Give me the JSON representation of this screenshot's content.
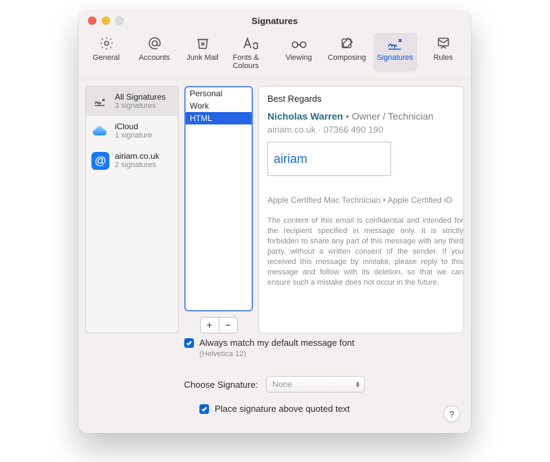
{
  "window": {
    "title": "Signatures"
  },
  "toolbar": {
    "items": [
      {
        "id": "general",
        "label": "General"
      },
      {
        "id": "accounts",
        "label": "Accounts"
      },
      {
        "id": "junk",
        "label": "Junk Mail"
      },
      {
        "id": "fonts",
        "label": "Fonts & Colours"
      },
      {
        "id": "viewing",
        "label": "Viewing"
      },
      {
        "id": "composing",
        "label": "Composing"
      },
      {
        "id": "signatures",
        "label": "Signatures"
      },
      {
        "id": "rules",
        "label": "Rules"
      }
    ],
    "selected": "signatures"
  },
  "accounts": [
    {
      "id": "all",
      "name": "All Signatures",
      "sub": "3 signatures",
      "icon": "signature"
    },
    {
      "id": "icloud",
      "name": "iCloud",
      "sub": "1 signature",
      "icon": "icloud"
    },
    {
      "id": "airiam",
      "name": "airiam.co.uk",
      "sub": "2 signatures",
      "icon": "at"
    }
  ],
  "accounts_selected": "all",
  "signatures": [
    "Personal",
    "Work",
    "HTML"
  ],
  "signature_selected": "HTML",
  "preview": {
    "name": "Best Regards",
    "person": "Nicholas Warren",
    "sep": " • ",
    "role": "Owner / Technician",
    "domain": "airiam.co.uk",
    "phone": "07366 490 190",
    "logo_text": "airiam",
    "cert": "Apple Certified Mac Technician • Apple Certified iO",
    "disclaimer": "The content of this email is confidential and intended for the recipient specified in message only. It is strictly forbidden to share any part of this message with any third party, without a written consent of the sender. If you received this message by mistake, please reply to this message and follow with its deletion, so that we can ensure such a mistake does not occur in the future."
  },
  "buttons": {
    "add": "+",
    "remove": "−"
  },
  "options": {
    "match_font_label": "Always match my default message font",
    "match_font_note": "(Helvetica 12)",
    "choose_label": "Choose Signature:",
    "choose_value": "None",
    "place_above_label": "Place signature above quoted text"
  },
  "help": "?"
}
